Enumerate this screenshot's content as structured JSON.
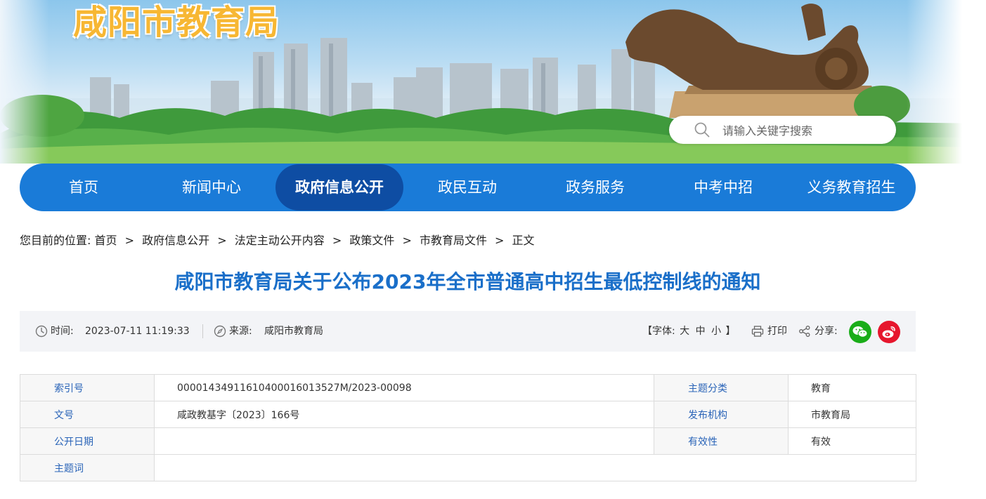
{
  "header": {
    "site_title": "咸阳市教育局",
    "search": {
      "placeholder": "请输入关键字搜索"
    }
  },
  "nav": {
    "items": [
      {
        "label": "首页"
      },
      {
        "label": "新闻中心"
      },
      {
        "label": "政府信息公开"
      },
      {
        "label": "政民互动"
      },
      {
        "label": "政务服务"
      },
      {
        "label": "中考中招"
      },
      {
        "label": "义务教育招生"
      }
    ],
    "active_index": 2
  },
  "breadcrumb": {
    "prefix": "您目前的位置:",
    "items": [
      "首页",
      "政府信息公开",
      "法定主动公开内容",
      "政策文件",
      "市教育局文件",
      "正文"
    ],
    "separator": ">"
  },
  "article": {
    "title": "咸阳市教育局关于公布2023年全市普通高中招生最低控制线的通知"
  },
  "meta": {
    "time_label": "时间:",
    "time_value": "2023-07-11 11:19:33",
    "source_label": "来源:",
    "source_value": "咸阳市教育局",
    "font_open": "【字体:",
    "font_sizes": [
      "大",
      "中",
      "小"
    ],
    "font_close": "】",
    "print_label": "打印",
    "share_label": "分享:"
  },
  "info_table": {
    "rows": [
      {
        "label1": "索引号",
        "value1": "000014349116104000160135 27M/2023-00098",
        "label2": "主题分类",
        "value2": "教育"
      },
      {
        "label1": "文号",
        "value1": "咸政教基字〔2023〕166号",
        "label2": "发布机构",
        "value2": "市教育局"
      },
      {
        "label1": "公开日期",
        "value1": "",
        "label2": "有效性",
        "value2": "有效"
      },
      {
        "label1": "主题词",
        "value1": ""
      }
    ]
  },
  "colors": {
    "nav_bg": "#1a7bd8",
    "nav_active": "#0e4da3",
    "title_blue": "#1a6fc9",
    "label_blue": "#2a64b8",
    "site_title_orange": "#f7b733",
    "wechat_green": "#1aad19",
    "weibo_red": "#e6162d"
  }
}
